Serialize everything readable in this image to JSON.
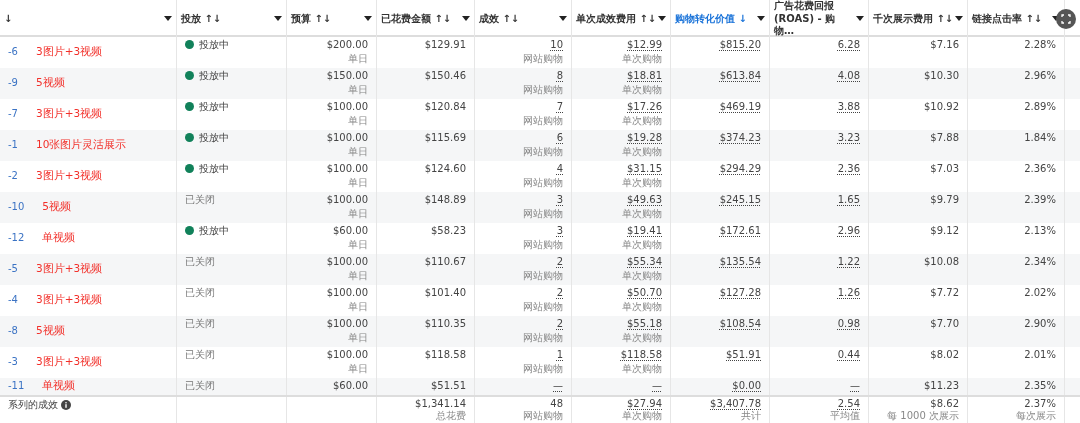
{
  "table": {
    "columns": [
      {
        "label": "↓",
        "sorted": false
      },
      {
        "label": "投放 ↑↓",
        "sorted": false
      },
      {
        "label": "预算 ↑↓",
        "sorted": false
      },
      {
        "label": "已花费金额 ↑↓",
        "sorted": false
      },
      {
        "label": "成效 ↑↓",
        "sorted": false
      },
      {
        "label": "单次成效费用 ↑↓",
        "sorted": false
      },
      {
        "label": "购物转化价值 ↓",
        "sorted": true
      },
      {
        "label": "广告花费回报 (ROAS) - 购物…",
        "sorted": false
      },
      {
        "label": "千次展示费用 ↑↓",
        "sorted": false
      },
      {
        "label": "链接点击率 ↑↓",
        "sorted": false
      }
    ],
    "rows": [
      {
        "name": "-6",
        "note": "3图片+3视频",
        "active": true,
        "status": "投放中",
        "budget": "$200.00",
        "budget_sub": "单日",
        "spent": "$129.91",
        "results": "10",
        "results_sub": "网站购物",
        "cpr": "$12.99",
        "cpr_sub": "单次购物",
        "value": "$815.20",
        "roas": "6.28",
        "cpm": "$7.16",
        "ctr": "2.28%"
      },
      {
        "name": "-9",
        "note": "5视频",
        "active": true,
        "status": "投放中",
        "budget": "$150.00",
        "budget_sub": "单日",
        "spent": "$150.46",
        "results": "8",
        "results_sub": "网站购物",
        "cpr": "$18.81",
        "cpr_sub": "单次购物",
        "value": "$613.84",
        "roas": "4.08",
        "cpm": "$10.30",
        "ctr": "2.96%"
      },
      {
        "name": "-7",
        "note": "3图片+3视频",
        "active": true,
        "status": "投放中",
        "budget": "$100.00",
        "budget_sub": "单日",
        "spent": "$120.84",
        "results": "7",
        "results_sub": "网站购物",
        "cpr": "$17.26",
        "cpr_sub": "单次购物",
        "value": "$469.19",
        "roas": "3.88",
        "cpm": "$10.92",
        "ctr": "2.89%"
      },
      {
        "name": "-1",
        "note": "10张图片灵活展示",
        "active": true,
        "status": "投放中",
        "budget": "$100.00",
        "budget_sub": "单日",
        "spent": "$115.69",
        "results": "6",
        "results_sub": "网站购物",
        "cpr": "$19.28",
        "cpr_sub": "单次购物",
        "value": "$374.23",
        "roas": "3.23",
        "cpm": "$7.88",
        "ctr": "1.84%"
      },
      {
        "name": "-2",
        "note": "3图片+3视频",
        "active": true,
        "status": "投放中",
        "budget": "$100.00",
        "budget_sub": "单日",
        "spent": "$124.60",
        "results": "4",
        "results_sub": "网站购物",
        "cpr": "$31.15",
        "cpr_sub": "单次购物",
        "value": "$294.29",
        "roas": "2.36",
        "cpm": "$7.03",
        "ctr": "2.36%"
      },
      {
        "name": "-10",
        "note": "5视频",
        "active": false,
        "status": "已关闭",
        "budget": "$100.00",
        "budget_sub": "单日",
        "spent": "$148.89",
        "results": "3",
        "results_sub": "网站购物",
        "cpr": "$49.63",
        "cpr_sub": "单次购物",
        "value": "$245.15",
        "roas": "1.65",
        "cpm": "$9.79",
        "ctr": "2.39%"
      },
      {
        "name": "-12",
        "note": "单视频",
        "active": true,
        "status": "投放中",
        "budget": "$60.00",
        "budget_sub": "单日",
        "spent": "$58.23",
        "results": "3",
        "results_sub": "网站购物",
        "cpr": "$19.41",
        "cpr_sub": "单次购物",
        "value": "$172.61",
        "roas": "2.96",
        "cpm": "$9.12",
        "ctr": "2.13%"
      },
      {
        "name": "-5",
        "note": "3图片+3视频",
        "active": false,
        "status": "已关闭",
        "budget": "$100.00",
        "budget_sub": "单日",
        "spent": "$110.67",
        "results": "2",
        "results_sub": "网站购物",
        "cpr": "$55.34",
        "cpr_sub": "单次购物",
        "value": "$135.54",
        "roas": "1.22",
        "cpm": "$10.08",
        "ctr": "2.34%"
      },
      {
        "name": "-4",
        "note": "3图片+3视频",
        "active": false,
        "status": "已关闭",
        "budget": "$100.00",
        "budget_sub": "单日",
        "spent": "$101.40",
        "results": "2",
        "results_sub": "网站购物",
        "cpr": "$50.70",
        "cpr_sub": "单次购物",
        "value": "$127.28",
        "roas": "1.26",
        "cpm": "$7.72",
        "ctr": "2.02%"
      },
      {
        "name": "-8",
        "note": "5视频",
        "active": false,
        "status": "已关闭",
        "budget": "$100.00",
        "budget_sub": "单日",
        "spent": "$110.35",
        "results": "2",
        "results_sub": "网站购物",
        "cpr": "$55.18",
        "cpr_sub": "单次购物",
        "value": "$108.54",
        "roas": "0.98",
        "cpm": "$7.70",
        "ctr": "2.90%"
      },
      {
        "name": "-3",
        "note": "3图片+3视频",
        "active": false,
        "status": "已关闭",
        "budget": "$100.00",
        "budget_sub": "单日",
        "spent": "$118.58",
        "results": "1",
        "results_sub": "网站购物",
        "cpr": "$118.58",
        "cpr_sub": "单次购物",
        "value": "$51.91",
        "roas": "0.44",
        "cpm": "$8.02",
        "ctr": "2.01%"
      },
      {
        "name": "-11",
        "note": "单视频",
        "active": false,
        "status": "已关闭",
        "budget": "$60.00",
        "spent": "$51.51",
        "results": "—",
        "cpr": "—",
        "value": "$0.00",
        "roas": "—",
        "cpm": "$11.23",
        "ctr": "2.35%"
      }
    ],
    "footer": {
      "label": "系列的成效",
      "spent": "$1,341.14",
      "spent_sub": "总花费",
      "results": "48",
      "results_sub": "网站购物",
      "cpr": "$27.94",
      "cpr_sub": "单次购物",
      "value": "$3,407.78",
      "value_sub": "共计",
      "roas": "2.54",
      "roas_sub": "平均值",
      "cpm": "$8.62",
      "cpm_sub": "每 1000 次展示",
      "ctr": "2.37%",
      "ctr_sub": "每次展示"
    }
  }
}
